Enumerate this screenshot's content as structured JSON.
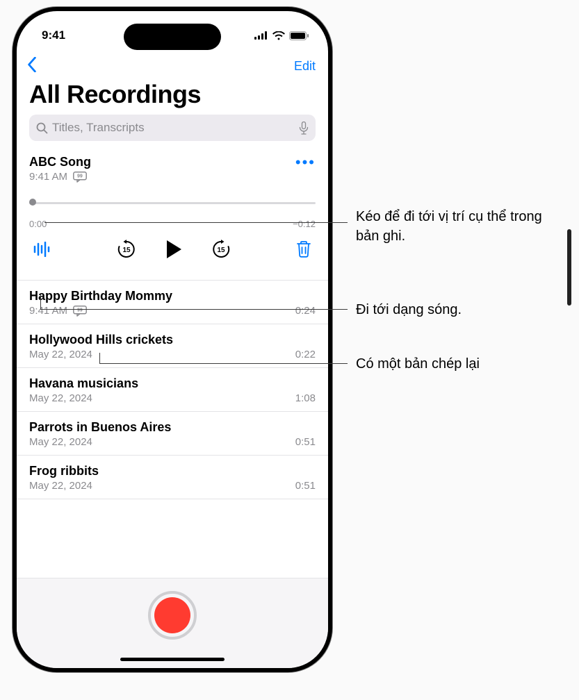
{
  "status": {
    "time": "9:41"
  },
  "nav": {
    "edit": "Edit"
  },
  "title": "All Recordings",
  "search": {
    "placeholder": "Titles, Transcripts"
  },
  "selected": {
    "title": "ABC Song",
    "time": "9:41 AM",
    "elapsed": "0:00",
    "remaining": "−0:12"
  },
  "recordings": [
    {
      "title": "Happy Birthday Mommy",
      "subtitle": "9:41 AM",
      "duration": "0:24",
      "transcript": true
    },
    {
      "title": "Hollywood Hills crickets",
      "subtitle": "May 22, 2024",
      "duration": "0:22",
      "transcript": false
    },
    {
      "title": "Havana musicians",
      "subtitle": "May 22, 2024",
      "duration": "1:08",
      "transcript": false
    },
    {
      "title": "Parrots in Buenos Aires",
      "subtitle": "May 22, 2024",
      "duration": "0:51",
      "transcript": false
    },
    {
      "title": "Frog ribbits",
      "subtitle": "May 22, 2024",
      "duration": "0:51",
      "transcript": false
    }
  ],
  "callouts": {
    "scrub": "Kéo để đi tới vị trí cụ thể trong bản ghi.",
    "waveform": "Đi tới dạng sóng.",
    "transcript": "Có một bản chép lại"
  }
}
